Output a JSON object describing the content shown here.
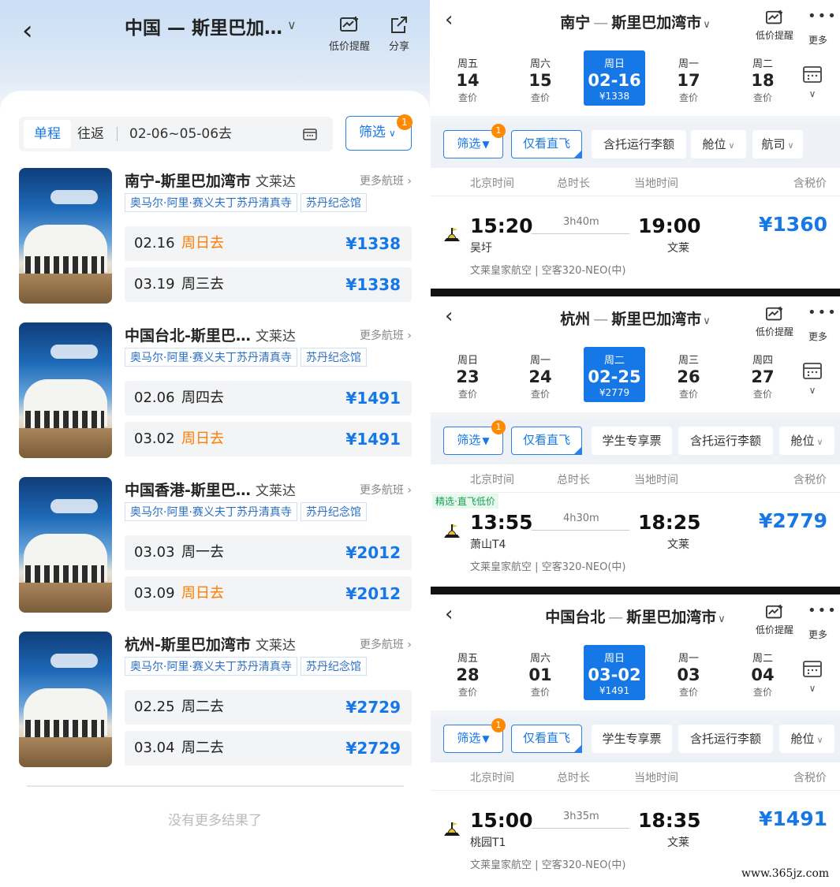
{
  "left": {
    "header": {
      "title": "中国 — 斯里巴加…",
      "price_alert": "低价提醒",
      "share": "分享"
    },
    "segment": {
      "one_way": "单程",
      "round_trip": "往返",
      "date_range": "02-06~05-06去"
    },
    "filter": {
      "label": "筛选",
      "badge": "1"
    },
    "routes": [
      {
        "name": "南宁-斯里巴加湾市",
        "sub": "文莱达",
        "more": "更多航班",
        "tags": [
          "奥马尔·阿里·赛义夫丁苏丹清真寺",
          "苏丹纪念馆"
        ],
        "rows": [
          {
            "date": "02.16",
            "weekday": "周日去",
            "price": "¥1338",
            "highlight": true
          },
          {
            "date": "03.19",
            "weekday": "周三去",
            "price": "¥1338",
            "highlight": false
          }
        ]
      },
      {
        "name": "中国台北-斯里巴…",
        "sub": "文莱达",
        "more": "更多航班",
        "tags": [
          "奥马尔·阿里·赛义夫丁苏丹清真寺",
          "苏丹纪念馆"
        ],
        "rows": [
          {
            "date": "02.06",
            "weekday": "周四去",
            "price": "¥1491",
            "highlight": false
          },
          {
            "date": "03.02",
            "weekday": "周日去",
            "price": "¥1491",
            "highlight": true
          }
        ]
      },
      {
        "name": "中国香港-斯里巴…",
        "sub": "文莱达",
        "more": "更多航班",
        "tags": [
          "奥马尔·阿里·赛义夫丁苏丹清真寺",
          "苏丹纪念馆"
        ],
        "rows": [
          {
            "date": "03.03",
            "weekday": "周一去",
            "price": "¥2012",
            "highlight": false
          },
          {
            "date": "03.09",
            "weekday": "周日去",
            "price": "¥2012",
            "highlight": true
          }
        ]
      },
      {
        "name": "杭州-斯里巴加湾市",
        "sub": "文莱达",
        "more": "更多航班",
        "tags": [
          "奥马尔·阿里·赛义夫丁苏丹清真寺",
          "苏丹纪念馆"
        ],
        "rows": [
          {
            "date": "02.25",
            "weekday": "周二去",
            "price": "¥2729",
            "highlight": false
          },
          {
            "date": "03.04",
            "weekday": "周二去",
            "price": "¥2729",
            "highlight": false
          }
        ]
      }
    ],
    "no_more": "没有更多结果了"
  },
  "panels": [
    {
      "from": "南宁",
      "to": "斯里巴加湾市",
      "price_alert": "低价提醒",
      "more": "更多",
      "dates": [
        {
          "wd": "周五",
          "day": "14",
          "price": "查价"
        },
        {
          "wd": "周六",
          "day": "15",
          "price": "查价"
        },
        {
          "wd": "周日",
          "day": "02-16",
          "price": "¥1338",
          "selected": true
        },
        {
          "wd": "周一",
          "day": "17",
          "price": "查价"
        },
        {
          "wd": "周二",
          "day": "18",
          "price": "查价"
        }
      ],
      "chips": [
        "筛选",
        "仅看直飞",
        "含托运行李额",
        "舱位",
        "航司"
      ],
      "heads": [
        "北京时间",
        "总时长",
        "当地时间",
        "含税价"
      ],
      "flight": {
        "tag": "",
        "dep": "15:20",
        "dep_airport": "吴圩",
        "duration": "3h40m",
        "arr": "19:00",
        "arr_airport": "文莱",
        "price": "¥1360",
        "airline": "文莱皇家航空 | 空客320-NEO(中)"
      }
    },
    {
      "from": "杭州",
      "to": "斯里巴加湾市",
      "price_alert": "低价提醒",
      "more": "更多",
      "dates": [
        {
          "wd": "周日",
          "day": "23",
          "price": "查价"
        },
        {
          "wd": "周一",
          "day": "24",
          "price": "查价"
        },
        {
          "wd": "周二",
          "day": "02-25",
          "price": "¥2779",
          "selected": true
        },
        {
          "wd": "周三",
          "day": "26",
          "price": "查价"
        },
        {
          "wd": "周四",
          "day": "27",
          "price": "查价"
        }
      ],
      "chips": [
        "筛选",
        "仅看直飞",
        "学生专享票",
        "含托运行李额",
        "舱位"
      ],
      "heads": [
        "北京时间",
        "总时长",
        "当地时间",
        "含税价"
      ],
      "flight": {
        "tag": "精选·直飞低价",
        "dep": "13:55",
        "dep_airport": "萧山T4",
        "duration": "4h30m",
        "arr": "18:25",
        "arr_airport": "文莱",
        "price": "¥2779",
        "airline": "文莱皇家航空 | 空客320-NEO(中)"
      }
    },
    {
      "from": "中国台北",
      "to": "斯里巴加湾市",
      "price_alert": "低价提醒",
      "more": "更多",
      "dates": [
        {
          "wd": "周五",
          "day": "28",
          "price": "查价"
        },
        {
          "wd": "周六",
          "day": "01",
          "price": "查价"
        },
        {
          "wd": "周日",
          "day": "03-02",
          "price": "¥1491",
          "selected": true
        },
        {
          "wd": "周一",
          "day": "03",
          "price": "查价"
        },
        {
          "wd": "周二",
          "day": "04",
          "price": "查价"
        }
      ],
      "chips": [
        "筛选",
        "仅看直飞",
        "学生专享票",
        "含托运行李额",
        "舱位"
      ],
      "heads": [
        "北京时间",
        "总时长",
        "当地时间",
        "含税价"
      ],
      "flight": {
        "tag": "",
        "dep": "15:00",
        "dep_airport": "桃园T1",
        "duration": "3h35m",
        "arr": "18:35",
        "arr_airport": "文莱",
        "price": "¥1491",
        "airline": "文莱皇家航空 | 空客320-NEO(中)"
      }
    }
  ],
  "watermark": "www.365jz.com"
}
